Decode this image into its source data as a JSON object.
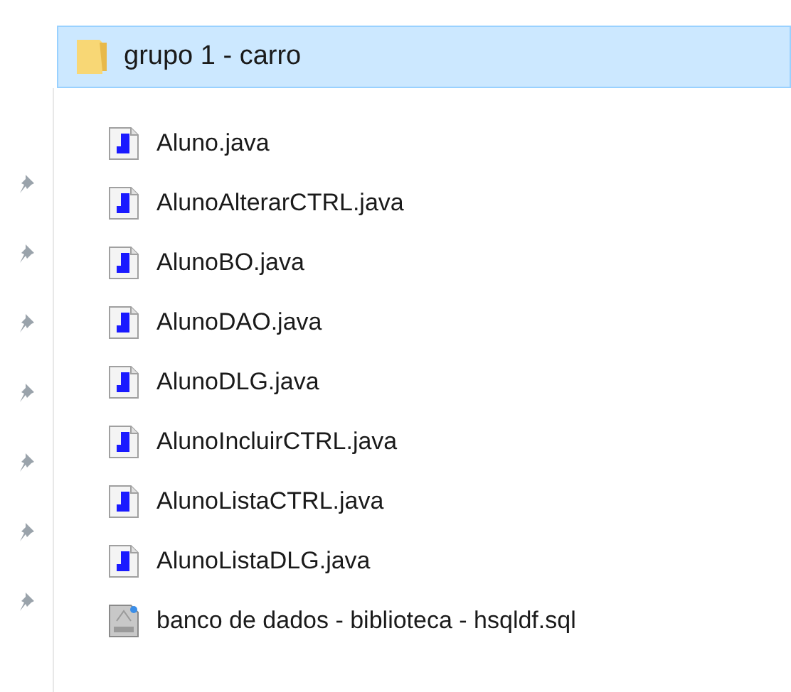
{
  "folder": {
    "name": "grupo 1 - carro",
    "selected": true
  },
  "files": [
    {
      "name": "Aluno.java",
      "kind": "java"
    },
    {
      "name": "AlunoAlterarCTRL.java",
      "kind": "java"
    },
    {
      "name": "AlunoBO.java",
      "kind": "java"
    },
    {
      "name": "AlunoDAO.java",
      "kind": "java"
    },
    {
      "name": "AlunoDLG.java",
      "kind": "java"
    },
    {
      "name": "AlunoIncluirCTRL.java",
      "kind": "java"
    },
    {
      "name": "AlunoListaCTRL.java",
      "kind": "java"
    },
    {
      "name": "AlunoListaDLG.java",
      "kind": "java"
    },
    {
      "name": "banco de dados - biblioteca - hsqldf.sql",
      "kind": "sql"
    }
  ]
}
